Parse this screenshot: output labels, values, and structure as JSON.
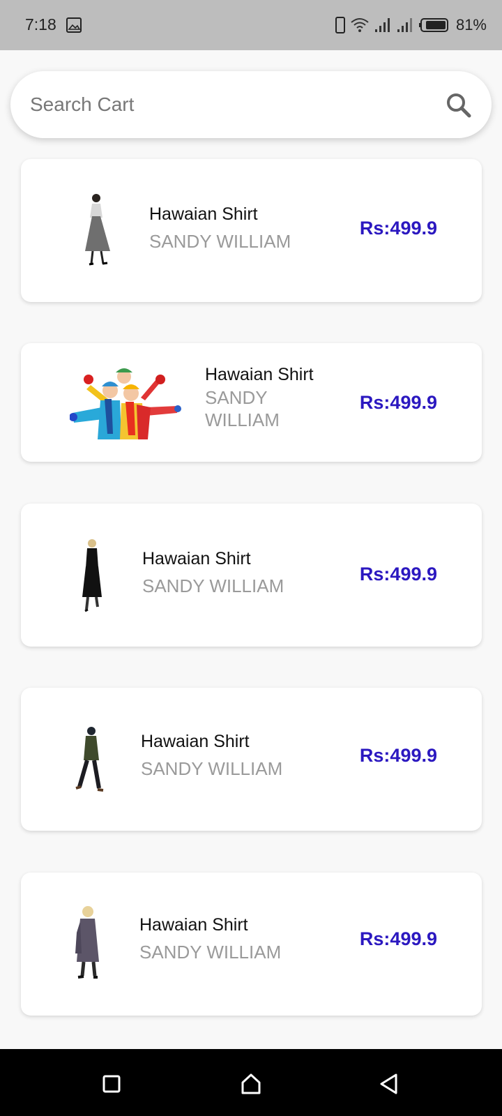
{
  "status_bar": {
    "time": "7:18",
    "battery": "81%",
    "icons": [
      "gallery-icon",
      "phone-icon",
      "wifi-icon",
      "signal-icon",
      "signal-icon",
      "battery-icon"
    ]
  },
  "search": {
    "placeholder": "Search Cart",
    "icon": "search-icon"
  },
  "cart_items": [
    {
      "name": "Hawaian Shirt",
      "seller": "SANDY WILLIAM",
      "price": "Rs:499.9",
      "image": "woman-grey-skirt"
    },
    {
      "name": "Hawaian Shirt",
      "seller": "SANDY WILLIAM",
      "price": "Rs:499.9",
      "image": "three-kids-winter"
    },
    {
      "name": "Hawaian Shirt",
      "seller": "SANDY WILLIAM",
      "price": "Rs:499.9",
      "image": "woman-black-dress"
    },
    {
      "name": "Hawaian Shirt",
      "seller": "SANDY WILLIAM",
      "price": "Rs:499.9",
      "image": "man-walking-jacket"
    },
    {
      "name": "Hawaian Shirt",
      "seller": "SANDY WILLIAM",
      "price": "Rs:499.9",
      "image": "woman-grey-dress"
    }
  ],
  "colors": {
    "price": "#2b18c0",
    "seller": "#9a9a9a",
    "status_bar": "#bdbdbd",
    "nav_bar": "#000000"
  },
  "nav_bar": {
    "buttons": [
      "recents-square-icon",
      "home-icon",
      "back-triangle-icon"
    ]
  }
}
